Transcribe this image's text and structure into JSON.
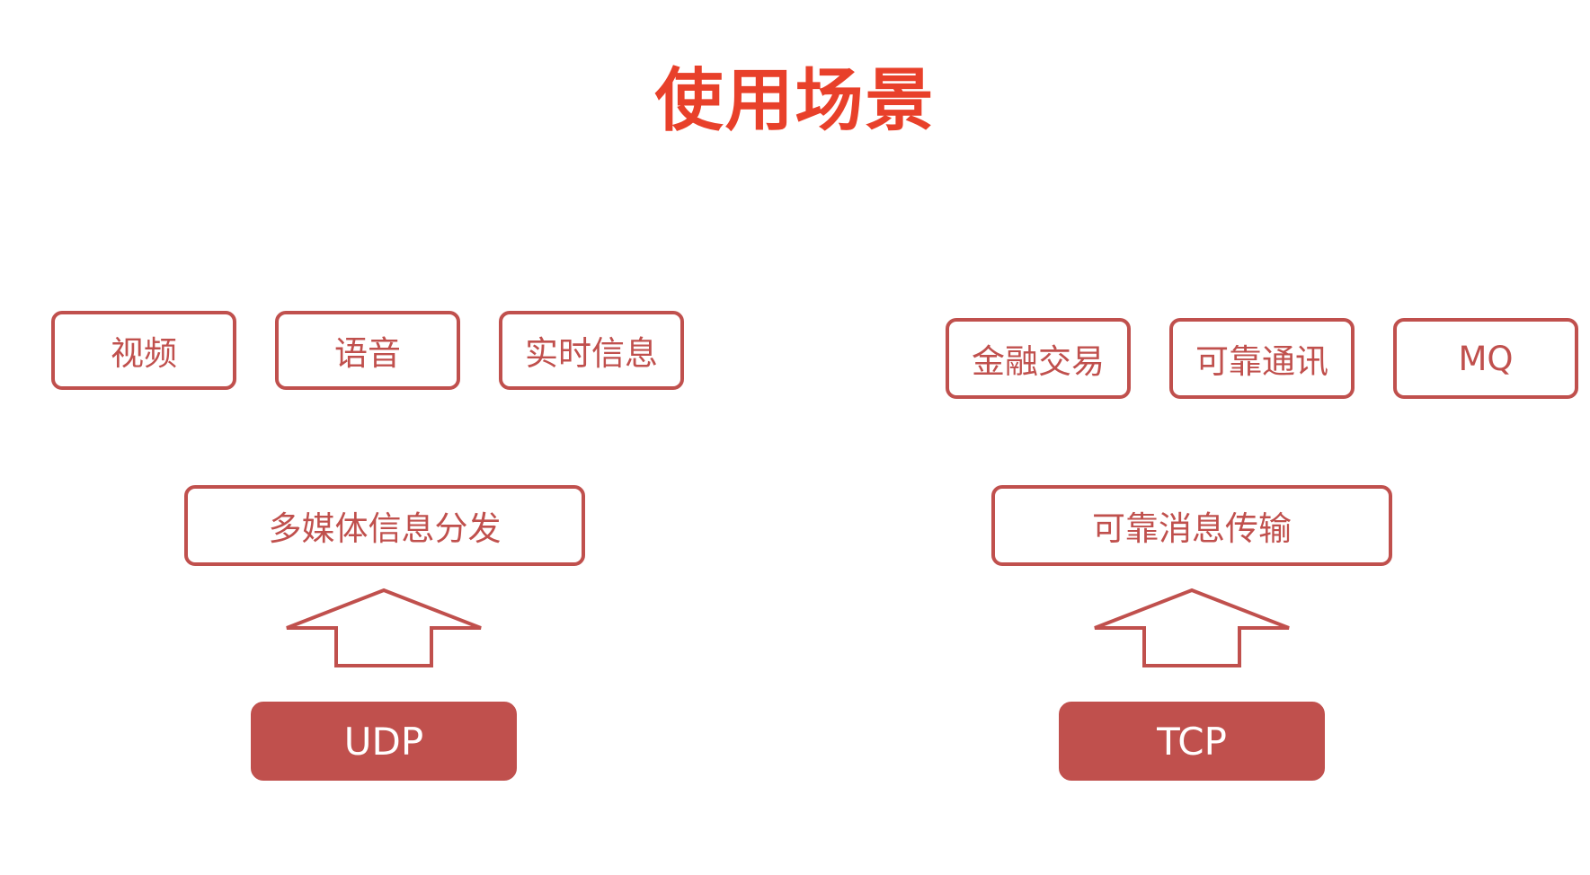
{
  "title": "使用场景",
  "udp": {
    "scenarios": [
      "视频",
      "语音",
      "实时信息"
    ],
    "category": "多媒体信息分发",
    "protocol": "UDP"
  },
  "tcp": {
    "scenarios": [
      "金融交易",
      "可靠通讯",
      "MQ"
    ],
    "category": "可靠消息传输",
    "protocol": "TCP"
  },
  "colors": {
    "title": "#e8402a",
    "accent": "#c0504d",
    "background": "#ffffff"
  },
  "icons": [
    "up-arrow-icon"
  ]
}
